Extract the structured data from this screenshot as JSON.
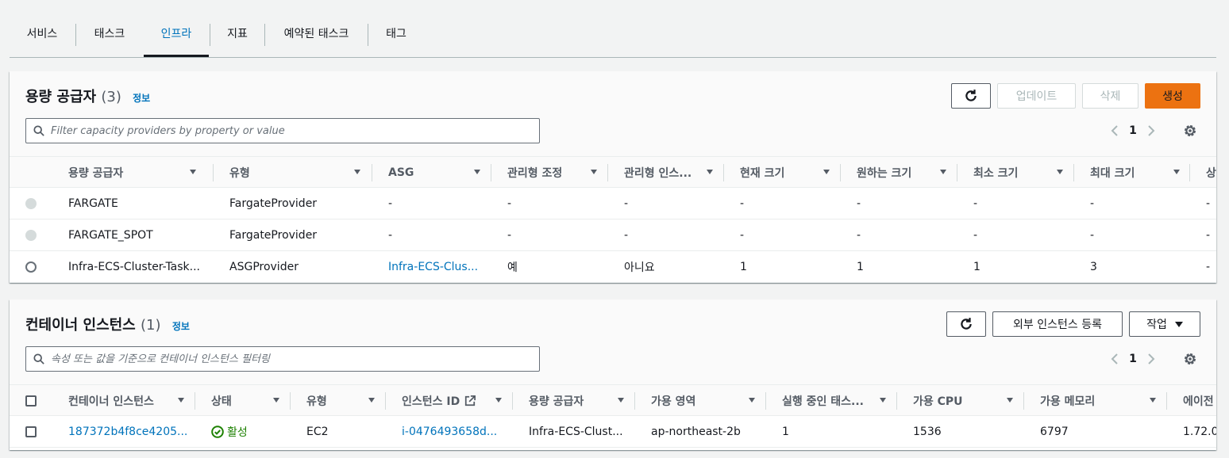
{
  "tabs": [
    {
      "label": "서비스"
    },
    {
      "label": "태스크"
    },
    {
      "label": "인프라"
    },
    {
      "label": "지표"
    },
    {
      "label": "예약된 태스크"
    },
    {
      "label": "태그"
    }
  ],
  "active_tab": "인프라",
  "capacity": {
    "title": "용량 공급자",
    "count": "(3)",
    "info": "정보",
    "buttons": {
      "update": "업데이트",
      "delete": "삭제",
      "create": "생성"
    },
    "filter_placeholder": "Filter capacity providers by property or value",
    "page": "1",
    "columns": [
      "용량 공급자",
      "유형",
      "ASG",
      "관리형 조정",
      "관리형 인스...",
      "현재 크기",
      "원하는 크기",
      "최소 크기",
      "최대 크기",
      "상"
    ],
    "rows": [
      {
        "cells": [
          "FARGATE",
          "FargateProvider",
          "-",
          "-",
          "-",
          "-",
          "-",
          "-",
          "-",
          "-"
        ]
      },
      {
        "cells": [
          "FARGATE_SPOT",
          "FargateProvider",
          "-",
          "-",
          "-",
          "-",
          "-",
          "-",
          "-",
          "-"
        ]
      },
      {
        "cells": [
          "Infra-ECS-Cluster-Task...",
          "ASGProvider",
          "Infra-ECS-Clus...",
          "예",
          "아니요",
          "1",
          "1",
          "1",
          "3",
          "-"
        ]
      }
    ]
  },
  "instances": {
    "title": "컨테이너 인스턴스",
    "count": "(1)",
    "info": "정보",
    "buttons": {
      "register": "외부 인스턴스 등록",
      "actions": "작업"
    },
    "filter_placeholder": "속성 또는 값을 기준으로 컨테이너 인스턴스 필터링",
    "page": "1",
    "columns": [
      "컨테이너 인스턴스",
      "상태",
      "유형",
      "인스턴스 ID",
      "용량 공급자",
      "가용 영역",
      "실행 중인 태스...",
      "가용 CPU",
      "가용 메모리",
      "에이전"
    ],
    "rows": [
      {
        "cells": [
          "187372b4f8ce4205...",
          "활성",
          "EC2",
          "i-0476493658d...",
          "Infra-ECS-Clust...",
          "ap-northeast-2b",
          "1",
          "1536",
          "6797",
          "1.72.0"
        ]
      }
    ]
  },
  "colors": {
    "link": "#0073bb",
    "primary": "#ec7211",
    "success": "#1d8102"
  }
}
